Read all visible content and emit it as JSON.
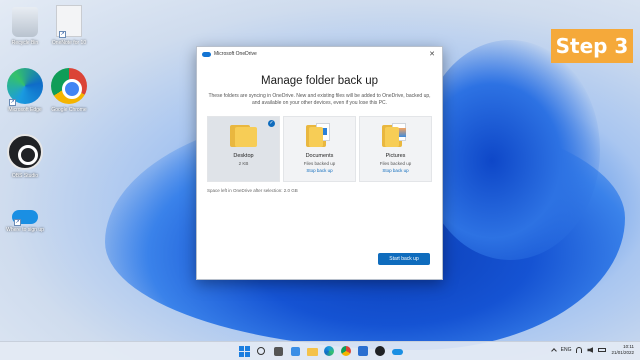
{
  "desktop": {
    "icons": [
      {
        "label": "Recycle Bin",
        "icon": "recycle-bin-icon"
      },
      {
        "label": "OneNote for 10",
        "icon": "document-icon"
      },
      {
        "label": "Microsoft Edge",
        "icon": "edge-icon"
      },
      {
        "label": "Google Chrome",
        "icon": "chrome-icon"
      },
      {
        "label": "OBS Studio",
        "icon": "obs-icon"
      },
      {
        "label": "Where to sign up",
        "icon": "onedrive-icon"
      }
    ]
  },
  "badge": {
    "label": "Step 3",
    "color": "#f5a93a"
  },
  "dialog": {
    "window_title": "Microsoft OneDrive",
    "close_glyph": "✕",
    "heading": "Manage folder back up",
    "description": "These folders are syncing in OneDrive. New and existing files will be added to OneDrive, backed up, and available on your other devices, even if you lose this PC.",
    "folders": [
      {
        "name": "Desktop",
        "detail": "2 KB",
        "selected": true,
        "check": "✓"
      },
      {
        "name": "Documents",
        "detail": "Files backed up",
        "link": "Stop back up"
      },
      {
        "name": "Pictures",
        "detail": "Files backed up",
        "link": "Stop back up"
      }
    ],
    "space_note": "Space left in OneDrive after selection: 2.0 GB",
    "start_button": "Start back up",
    "accent": "#0f6cbd"
  },
  "taskbar": {
    "tray": {
      "language": "ENG",
      "time": "10:11",
      "date": "21/01/2022"
    }
  }
}
